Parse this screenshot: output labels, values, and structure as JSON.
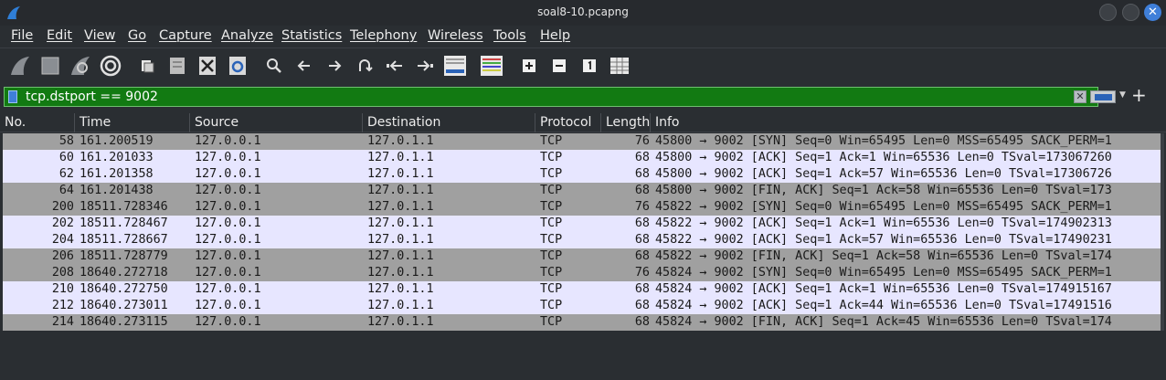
{
  "window": {
    "title": "soal8-10.pcapng"
  },
  "menu": [
    "File",
    "Edit",
    "View",
    "Go",
    "Capture",
    "Analyze",
    "Statistics",
    "Telephony",
    "Wireless",
    "Tools",
    "Help"
  ],
  "toolbar": {
    "icons": [
      "start-capture-icon",
      "stop-capture-icon",
      "restart-capture-icon",
      "capture-options-icon",
      "open-file-icon",
      "save-file-icon",
      "close-file-icon",
      "reload-file-icon",
      "find-packet-icon",
      "go-back-icon",
      "go-forward-icon",
      "go-to-packet-icon",
      "go-first-packet-icon",
      "go-last-packet-icon",
      "auto-scroll-icon",
      "colorize-icon",
      "zoom-in-icon",
      "zoom-out-icon",
      "normal-size-icon",
      "resize-columns-icon"
    ]
  },
  "filter": {
    "value": "tcp.dstport == 9002",
    "color": "#127a12"
  },
  "columns": [
    "No.",
    "Time",
    "Source",
    "Destination",
    "Protocol",
    "Length",
    "Info"
  ],
  "packets": [
    {
      "no": "58",
      "time": "161.200519",
      "src": "127.0.0.1",
      "dst": "127.0.1.1",
      "proto": "TCP",
      "len": "76",
      "info": "45800 → 9002 [SYN] Seq=0 Win=65495 Len=0 MSS=65495 SACK_PERM=1",
      "style": "gray"
    },
    {
      "no": "60",
      "time": "161.201033",
      "src": "127.0.0.1",
      "dst": "127.0.1.1",
      "proto": "TCP",
      "len": "68",
      "info": "45800 → 9002 [ACK] Seq=1 Ack=1 Win=65536 Len=0 TSval=173067260",
      "style": "light"
    },
    {
      "no": "62",
      "time": "161.201358",
      "src": "127.0.0.1",
      "dst": "127.0.1.1",
      "proto": "TCP",
      "len": "68",
      "info": "45800 → 9002 [ACK] Seq=1 Ack=57 Win=65536 Len=0 TSval=17306726",
      "style": "light"
    },
    {
      "no": "64",
      "time": "161.201438",
      "src": "127.0.0.1",
      "dst": "127.0.1.1",
      "proto": "TCP",
      "len": "68",
      "info": "45800 → 9002 [FIN, ACK] Seq=1 Ack=58 Win=65536 Len=0 TSval=173",
      "style": "gray"
    },
    {
      "no": "200",
      "time": "18511.728346",
      "src": "127.0.0.1",
      "dst": "127.0.1.1",
      "proto": "TCP",
      "len": "76",
      "info": "45822 → 9002 [SYN] Seq=0 Win=65495 Len=0 MSS=65495 SACK_PERM=1",
      "style": "gray"
    },
    {
      "no": "202",
      "time": "18511.728467",
      "src": "127.0.0.1",
      "dst": "127.0.1.1",
      "proto": "TCP",
      "len": "68",
      "info": "45822 → 9002 [ACK] Seq=1 Ack=1 Win=65536 Len=0 TSval=174902313",
      "style": "light"
    },
    {
      "no": "204",
      "time": "18511.728667",
      "src": "127.0.0.1",
      "dst": "127.0.1.1",
      "proto": "TCP",
      "len": "68",
      "info": "45822 → 9002 [ACK] Seq=1 Ack=57 Win=65536 Len=0 TSval=17490231",
      "style": "light"
    },
    {
      "no": "206",
      "time": "18511.728779",
      "src": "127.0.0.1",
      "dst": "127.0.1.1",
      "proto": "TCP",
      "len": "68",
      "info": "45822 → 9002 [FIN, ACK] Seq=1 Ack=58 Win=65536 Len=0 TSval=174",
      "style": "gray"
    },
    {
      "no": "208",
      "time": "18640.272718",
      "src": "127.0.0.1",
      "dst": "127.0.1.1",
      "proto": "TCP",
      "len": "76",
      "info": "45824 → 9002 [SYN] Seq=0 Win=65495 Len=0 MSS=65495 SACK_PERM=1",
      "style": "gray"
    },
    {
      "no": "210",
      "time": "18640.272750",
      "src": "127.0.0.1",
      "dst": "127.0.1.1",
      "proto": "TCP",
      "len": "68",
      "info": "45824 → 9002 [ACK] Seq=1 Ack=1 Win=65536 Len=0 TSval=174915167",
      "style": "light"
    },
    {
      "no": "212",
      "time": "18640.273011",
      "src": "127.0.0.1",
      "dst": "127.0.1.1",
      "proto": "TCP",
      "len": "68",
      "info": "45824 → 9002 [ACK] Seq=1 Ack=44 Win=65536 Len=0 TSval=17491516",
      "style": "light"
    },
    {
      "no": "214",
      "time": "18640.273115",
      "src": "127.0.0.1",
      "dst": "127.0.1.1",
      "proto": "TCP",
      "len": "68",
      "info": "45824 → 9002 [FIN, ACK] Seq=1 Ack=45 Win=65536 Len=0 TSval=174",
      "style": "gray"
    }
  ]
}
